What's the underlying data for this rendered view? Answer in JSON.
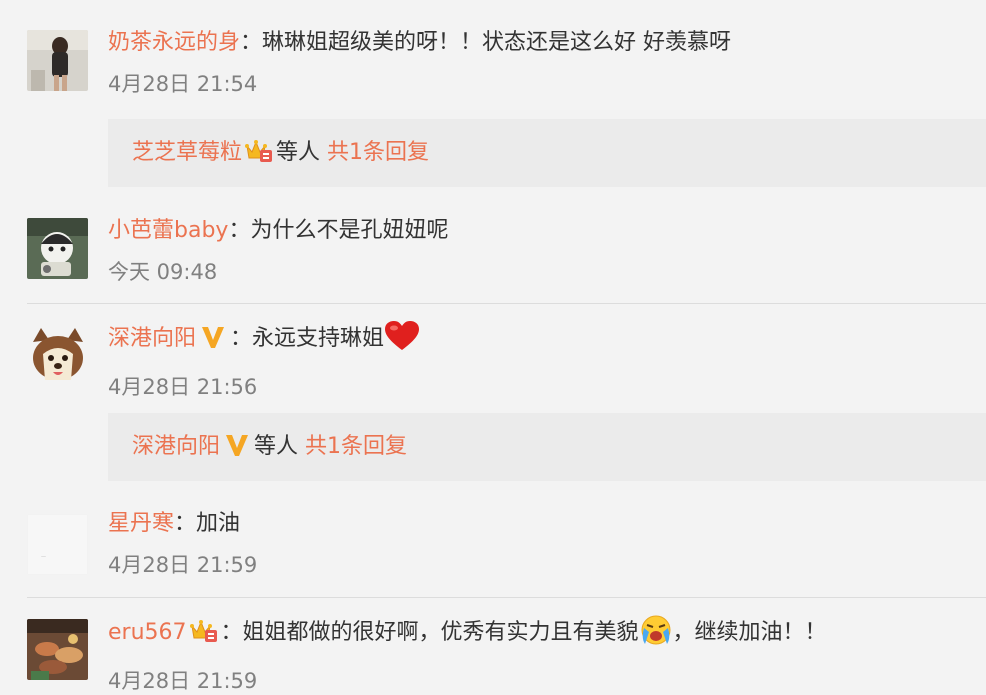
{
  "comments": [
    {
      "user": "奶茶永远的身",
      "colon": "：",
      "text": "琳琳姐超级美的呀！！状态还是这么好 好羡慕呀",
      "time": "4月28日 21:54",
      "reply": {
        "user": "芝芝草莓粒",
        "middle": "等人",
        "count": "共1条回复"
      }
    },
    {
      "user": "小芭蕾baby",
      "colon": "：",
      "text": "为什么不是孔妞妞呢",
      "time": "今天 09:48"
    },
    {
      "user": "深港向阳",
      "colon": "：",
      "text": "永远支持琳姐",
      "time": "4月28日 21:56",
      "reply": {
        "user": "深港向阳",
        "middle": "等人",
        "count": "共1条回复"
      }
    },
    {
      "user": "星丹寒",
      "colon": "：",
      "text": "加油",
      "time": "4月28日 21:59"
    },
    {
      "user": "eru567",
      "colon": "：",
      "text_a": "姐姐都做的很好啊，优秀有实力且有美貌",
      "text_b": "，继续加油！！",
      "time": "4月28日 21:59"
    }
  ],
  "icons": {
    "member_badge": "crown-member-badge-icon",
    "verified": "verified-v-icon",
    "heart": "heart-emoji-icon",
    "emoji": "crying-face-emoji-icon"
  },
  "colors": {
    "username": "#eb7350",
    "text": "#333333",
    "time": "#808080",
    "background": "#f3f3f3",
    "reply_box": "#ebebeb",
    "verified": "#f5a623",
    "heart": "#e0201e"
  }
}
